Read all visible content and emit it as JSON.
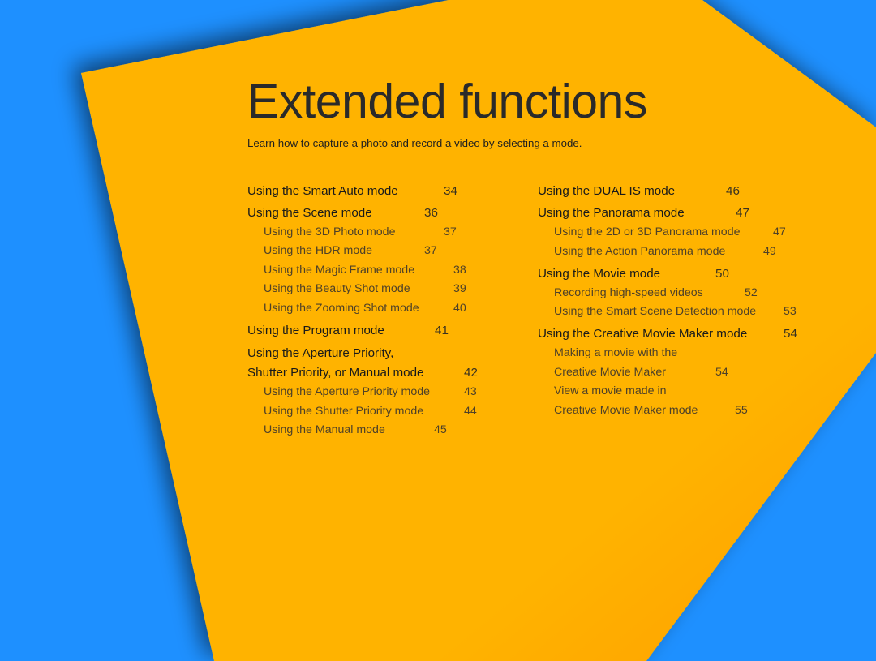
{
  "page": {
    "title": "Extended functions",
    "subtitle": "Learn how to capture a photo and record a video by selecting a mode.",
    "colors": {
      "background": "#1E90FF",
      "panel": "#FFB300",
      "panel_shade": "#FFA000",
      "text_main": "#1a1a1a",
      "text_sub": "#4f4128"
    }
  },
  "toc": {
    "left": [
      {
        "label": "Using the Smart Auto mode",
        "page": "34",
        "level": "main"
      },
      {
        "label": "Using the Scene mode",
        "page": "36",
        "level": "main"
      },
      {
        "label": "Using the 3D Photo mode",
        "page": "37",
        "level": "sub"
      },
      {
        "label": "Using the HDR mode",
        "page": "37",
        "level": "sub"
      },
      {
        "label": "Using the Magic Frame mode",
        "page": "38",
        "level": "sub"
      },
      {
        "label": "Using the Beauty Shot mode",
        "page": "39",
        "level": "sub"
      },
      {
        "label": "Using the Zooming Shot mode",
        "page": "40",
        "level": "sub"
      },
      {
        "label": "Using the Program mode",
        "page": "41",
        "level": "main"
      },
      {
        "label": "Using the Aperture Priority,",
        "page": "",
        "level": "main"
      },
      {
        "label": "Shutter Priority, or Manual mode",
        "page": "42",
        "level": "main"
      },
      {
        "label": "Using the Aperture Priority mode",
        "page": "43",
        "level": "sub"
      },
      {
        "label": "Using the Shutter Priority mode",
        "page": "44",
        "level": "sub"
      },
      {
        "label": "Using the Manual mode",
        "page": "45",
        "level": "sub"
      }
    ],
    "right": [
      {
        "label": "Using the DUAL IS mode",
        "page": "46",
        "level": "main"
      },
      {
        "label": "Using the Panorama mode",
        "page": "47",
        "level": "main"
      },
      {
        "label": "Using the 2D or 3D Panorama mode",
        "page": "47",
        "level": "sub"
      },
      {
        "label": "Using the Action Panorama mode",
        "page": "49",
        "level": "sub"
      },
      {
        "label": "Using the Movie mode",
        "page": "50",
        "level": "main"
      },
      {
        "label": "Recording high-speed videos",
        "page": "52",
        "level": "sub"
      },
      {
        "label": "Using the Smart Scene Detection mode",
        "page": "53",
        "level": "sub"
      },
      {
        "label": "Using the Creative Movie Maker mode",
        "page": "54",
        "level": "main"
      },
      {
        "label": "Making a movie with the",
        "page": "",
        "level": "sub"
      },
      {
        "label": "Creative Movie Maker",
        "page": "54",
        "level": "sub"
      },
      {
        "label": "View a movie made in",
        "page": "",
        "level": "sub"
      },
      {
        "label": "Creative Movie Maker mode",
        "page": "55",
        "level": "sub"
      }
    ]
  }
}
